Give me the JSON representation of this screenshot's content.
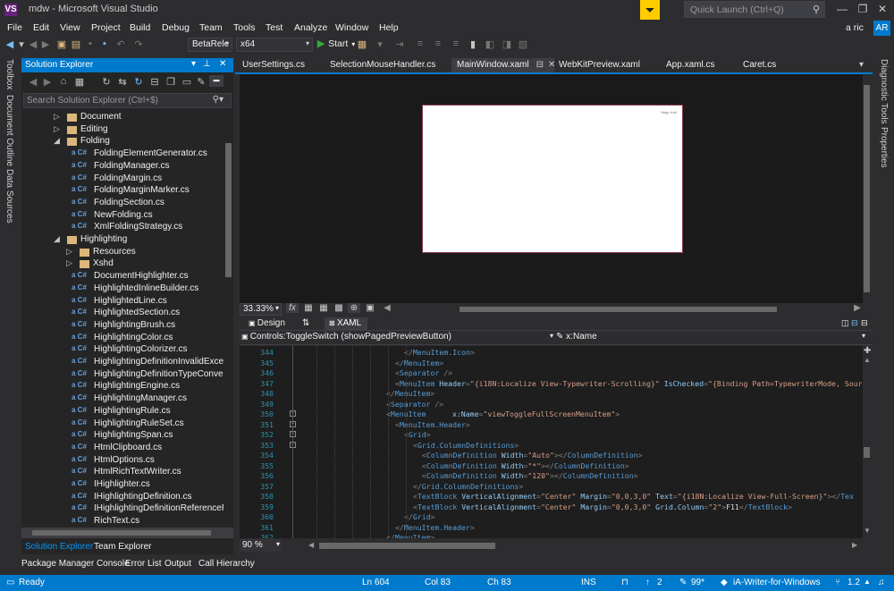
{
  "title_bar": {
    "logo": "VS",
    "title": "mdw - Microsoft Visual Studio",
    "notification_icon": "filter-flag-icon",
    "quick_launch_placeholder": "Quick Launch (Ctrl+Q)",
    "minimize": "—",
    "restore": "❐",
    "close": "✕"
  },
  "menu": {
    "items": [
      "File",
      "Edit",
      "View",
      "Project",
      "Build",
      "Debug",
      "Team",
      "Tools",
      "Test",
      "Analyze",
      "Window",
      "Help"
    ],
    "user": "a ric",
    "avatar": "AR"
  },
  "toolbar": {
    "config_value": "BetaRele",
    "platform_value": "x64",
    "start_label": "Start"
  },
  "left_strip": {
    "tabs": [
      "Toolbox",
      "Document Outline",
      "Data Sources"
    ]
  },
  "right_strip": {
    "tabs": [
      "Diagnostic Tools",
      "Properties"
    ]
  },
  "solution_explorer": {
    "title": "Solution Explorer",
    "search_placeholder": "Search Solution Explorer (Ctrl+$)",
    "tree": [
      {
        "label": "Document",
        "kind": "folder",
        "depth": 0,
        "state": "collapsed"
      },
      {
        "label": "Editing",
        "kind": "folder",
        "depth": 0,
        "state": "collapsed"
      },
      {
        "label": "Folding",
        "kind": "folder",
        "depth": 0,
        "state": "expanded"
      },
      {
        "label": "FoldingElementGenerator.cs",
        "kind": "cs",
        "depth": 1
      },
      {
        "label": "FoldingManager.cs",
        "kind": "cs",
        "depth": 1
      },
      {
        "label": "FoldingMargin.cs",
        "kind": "cs",
        "depth": 1
      },
      {
        "label": "FoldingMarginMarker.cs",
        "kind": "cs",
        "depth": 1
      },
      {
        "label": "FoldingSection.cs",
        "kind": "cs",
        "depth": 1
      },
      {
        "label": "NewFolding.cs",
        "kind": "cs",
        "depth": 1
      },
      {
        "label": "XmlFoldingStrategy.cs",
        "kind": "cs",
        "depth": 1
      },
      {
        "label": "Highlighting",
        "kind": "folder",
        "depth": 0,
        "state": "expanded"
      },
      {
        "label": "Resources",
        "kind": "folder",
        "depth": 1,
        "state": "collapsed"
      },
      {
        "label": "Xshd",
        "kind": "folder",
        "depth": 1,
        "state": "collapsed"
      },
      {
        "label": "DocumentHighlighter.cs",
        "kind": "cs",
        "depth": 1
      },
      {
        "label": "HighlightedInlineBuilder.cs",
        "kind": "cs",
        "depth": 1
      },
      {
        "label": "HighlightedLine.cs",
        "kind": "cs",
        "depth": 1
      },
      {
        "label": "HighlightedSection.cs",
        "kind": "cs",
        "depth": 1
      },
      {
        "label": "HighlightingBrush.cs",
        "kind": "cs",
        "depth": 1
      },
      {
        "label": "HighlightingColor.cs",
        "kind": "cs",
        "depth": 1
      },
      {
        "label": "HighlightingColorizer.cs",
        "kind": "cs",
        "depth": 1
      },
      {
        "label": "HighlightingDefinitionInvalidExcept",
        "kind": "cs",
        "depth": 1
      },
      {
        "label": "HighlightingDefinitionTypeConverte",
        "kind": "cs",
        "depth": 1
      },
      {
        "label": "HighlightingEngine.cs",
        "kind": "cs",
        "depth": 1
      },
      {
        "label": "HighlightingManager.cs",
        "kind": "cs",
        "depth": 1
      },
      {
        "label": "HighlightingRule.cs",
        "kind": "cs",
        "depth": 1
      },
      {
        "label": "HighlightingRuleSet.cs",
        "kind": "cs",
        "depth": 1
      },
      {
        "label": "HighlightingSpan.cs",
        "kind": "cs",
        "depth": 1
      },
      {
        "label": "HtmlClipboard.cs",
        "kind": "cs",
        "depth": 1
      },
      {
        "label": "HtmlOptions.cs",
        "kind": "cs",
        "depth": 1
      },
      {
        "label": "HtmlRichTextWriter.cs",
        "kind": "cs",
        "depth": 1
      },
      {
        "label": "IHighlighter.cs",
        "kind": "cs",
        "depth": 1
      },
      {
        "label": "IHighlightingDefinition.cs",
        "kind": "cs",
        "depth": 1
      },
      {
        "label": "IHighlightingDefinitionReferenceRe",
        "kind": "cs",
        "depth": 1
      },
      {
        "label": "RichText.cs",
        "kind": "cs",
        "depth": 1
      }
    ],
    "tabs": [
      "Solution Explorer",
      "Team Explorer"
    ]
  },
  "doc_tabs": [
    {
      "label": "UserSettings.cs",
      "active": false
    },
    {
      "label": "SelectionMouseHandler.cs",
      "active": false
    },
    {
      "label": "MainWindow.xaml",
      "active": true
    },
    {
      "label": "WebKitPreview.xaml",
      "active": false
    },
    {
      "label": "App.xaml.cs",
      "active": false
    },
    {
      "label": "Caret.cs",
      "active": false
    }
  ],
  "designer": {
    "zoom": "33.33%",
    "canvas_text": "Magic Hold"
  },
  "split": {
    "design_tab": "Design",
    "xaml_tab": "XAML",
    "swap_icon": "⇅"
  },
  "nav_bar": {
    "left": "Controls:ToggleSwitch (showPagedPreviewButton)",
    "right": "x:Name"
  },
  "editor": {
    "zoom": "90 %",
    "lines": [
      {
        "n": "344",
        "indent": 20,
        "html_segments": [
          [
            "br",
            "</"
          ],
          [
            "tg",
            "MenuItem.Icon"
          ],
          [
            "br",
            ">"
          ]
        ]
      },
      {
        "n": "345",
        "indent": 18,
        "html_segments": [
          [
            "br",
            "</"
          ],
          [
            "tg",
            "MenuItem"
          ],
          [
            "br",
            ">"
          ]
        ]
      },
      {
        "n": "346",
        "indent": 18,
        "html_segments": [
          [
            "br",
            "<"
          ],
          [
            "tg",
            "Separator"
          ],
          [
            "br",
            " />"
          ]
        ]
      },
      {
        "n": "347",
        "indent": 18,
        "html_segments": [
          [
            "br",
            "<"
          ],
          [
            "tg",
            "MenuItem"
          ],
          [
            "at",
            " Header"
          ],
          [
            "br",
            "="
          ],
          [
            "av",
            "\"{i18N:Localize View-Typewriter-Scrolling}\""
          ],
          [
            "at",
            " IsChecked"
          ],
          [
            "br",
            "="
          ],
          [
            "av",
            "\"{Binding Path=TypewriterMode, Source"
          ]
        ]
      },
      {
        "n": "348",
        "indent": 16,
        "html_segments": [
          [
            "br",
            "</"
          ],
          [
            "tg",
            "MenuItem"
          ],
          [
            "br",
            ">"
          ]
        ]
      },
      {
        "n": "349",
        "indent": 16,
        "html_segments": [
          [
            "br",
            "<"
          ],
          [
            "tg",
            "Separator"
          ],
          [
            "br",
            " />"
          ]
        ]
      },
      {
        "n": "350",
        "indent": 16,
        "html_segments": [
          [
            "br",
            "<"
          ],
          [
            "tg",
            "MenuItem"
          ],
          [
            "at",
            "      x:Name"
          ],
          [
            "br",
            "="
          ],
          [
            "av",
            "\"viewToggleFullScreenMenuItem\""
          ],
          [
            "br",
            ">"
          ]
        ]
      },
      {
        "n": "351",
        "indent": 18,
        "html_segments": [
          [
            "br",
            "<"
          ],
          [
            "tg",
            "MenuItem.Header"
          ],
          [
            "br",
            ">"
          ]
        ]
      },
      {
        "n": "352",
        "indent": 20,
        "html_segments": [
          [
            "br",
            "<"
          ],
          [
            "tg",
            "Grid"
          ],
          [
            "br",
            ">"
          ]
        ]
      },
      {
        "n": "353",
        "indent": 22,
        "html_segments": [
          [
            "br",
            "<"
          ],
          [
            "tg",
            "Grid.ColumnDefinitions"
          ],
          [
            "br",
            ">"
          ]
        ]
      },
      {
        "n": "354",
        "indent": 24,
        "html_segments": [
          [
            "br",
            "<"
          ],
          [
            "tg",
            "ColumnDefinition"
          ],
          [
            "at",
            " Width"
          ],
          [
            "br",
            "="
          ],
          [
            "av",
            "\"Auto\""
          ],
          [
            "br",
            "></"
          ],
          [
            "tg",
            "ColumnDefinition"
          ],
          [
            "br",
            ">"
          ]
        ]
      },
      {
        "n": "355",
        "indent": 24,
        "html_segments": [
          [
            "br",
            "<"
          ],
          [
            "tg",
            "ColumnDefinition"
          ],
          [
            "at",
            " Width"
          ],
          [
            "br",
            "="
          ],
          [
            "av",
            "\"*\""
          ],
          [
            "br",
            "></"
          ],
          [
            "tg",
            "ColumnDefinition"
          ],
          [
            "br",
            ">"
          ]
        ]
      },
      {
        "n": "356",
        "indent": 24,
        "html_segments": [
          [
            "br",
            "<"
          ],
          [
            "tg",
            "ColumnDefinition"
          ],
          [
            "at",
            " Width"
          ],
          [
            "br",
            "="
          ],
          [
            "av",
            "\"120\""
          ],
          [
            "br",
            "></"
          ],
          [
            "tg",
            "ColumnDefinition"
          ],
          [
            "br",
            ">"
          ]
        ]
      },
      {
        "n": "357",
        "indent": 22,
        "html_segments": [
          [
            "br",
            "</"
          ],
          [
            "tg",
            "Grid.ColumnDefinitions"
          ],
          [
            "br",
            ">"
          ]
        ]
      },
      {
        "n": "358",
        "indent": 22,
        "html_segments": [
          [
            "br",
            "<"
          ],
          [
            "tg",
            "TextBlock"
          ],
          [
            "at",
            " VerticalAlignment"
          ],
          [
            "br",
            "="
          ],
          [
            "av",
            "\"Center\""
          ],
          [
            "at",
            " Margin"
          ],
          [
            "br",
            "="
          ],
          [
            "av",
            "\"0,0,3,0\""
          ],
          [
            "at",
            " Text"
          ],
          [
            "br",
            "="
          ],
          [
            "av",
            "\"{i18N:Localize View-Full-Screen}\""
          ],
          [
            "br",
            "></"
          ],
          [
            "tg",
            "Tex"
          ]
        ]
      },
      {
        "n": "359",
        "indent": 22,
        "html_segments": [
          [
            "br",
            "<"
          ],
          [
            "tg",
            "TextBlock"
          ],
          [
            "at",
            " VerticalAlignment"
          ],
          [
            "br",
            "="
          ],
          [
            "av",
            "\"Center\""
          ],
          [
            "at",
            " Margin"
          ],
          [
            "br",
            "="
          ],
          [
            "av",
            "\"0,0,3,0\""
          ],
          [
            "at",
            " Grid.Column"
          ],
          [
            "br",
            "="
          ],
          [
            "av",
            "\"2\""
          ],
          [
            "br",
            ">"
          ],
          [
            "t",
            "F11"
          ],
          [
            "br",
            "</"
          ],
          [
            "tg",
            "TextBlock"
          ],
          [
            "br",
            ">"
          ]
        ]
      },
      {
        "n": "360",
        "indent": 20,
        "html_segments": [
          [
            "br",
            "</"
          ],
          [
            "tg",
            "Grid"
          ],
          [
            "br",
            ">"
          ]
        ]
      },
      {
        "n": "361",
        "indent": 18,
        "html_segments": [
          [
            "br",
            "</"
          ],
          [
            "tg",
            "MenuItem.Header"
          ],
          [
            "br",
            ">"
          ]
        ]
      },
      {
        "n": "362",
        "indent": 16,
        "html_segments": [
          [
            "br",
            "</"
          ],
          [
            "tg",
            "MenuItem"
          ],
          [
            "br",
            ">"
          ]
        ]
      }
    ]
  },
  "bottom_tabs": [
    "Package Manager Console",
    "Error List",
    "Output",
    "Call Hierarchy"
  ],
  "status": {
    "ready": "Ready",
    "ln": "Ln 604",
    "col": "Col 83",
    "ch": "Ch 83",
    "ins": "INS",
    "up_count": "2",
    "pencil_count": "99*",
    "repo": "iA-Writer-for-Windows",
    "version": "1.2"
  },
  "colors": {
    "accent": "#007acc",
    "background": "#2d2d30",
    "editor": "#1e1e1e",
    "folder": "#dcb67a"
  }
}
